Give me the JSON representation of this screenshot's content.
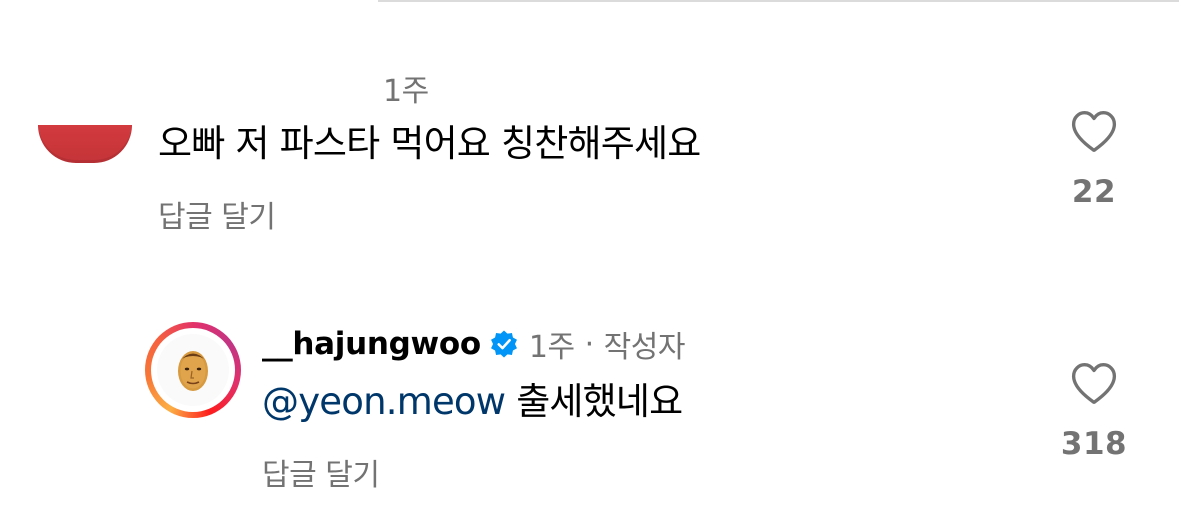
{
  "comment1": {
    "timestamp": "1주",
    "text": "오빠 저 파스타 먹어요 칭찬해주세요",
    "reply_label": "답글 달기",
    "like_count": "22",
    "avatar_color": "#cf383c"
  },
  "comment2": {
    "username": "__hajungwoo",
    "verified": true,
    "timestamp": "1주",
    "separator": "·",
    "author_badge": "작성자",
    "mention": "@yeon.meow",
    "text": "출세했네요",
    "reply_label": "답글 달기",
    "like_count": "318"
  },
  "icons": {
    "like": "heart-icon",
    "verified": "verified-badge-icon"
  },
  "colors": {
    "secondary_text": "#737373",
    "mention": "#00376b",
    "verified": "#0095f6"
  }
}
